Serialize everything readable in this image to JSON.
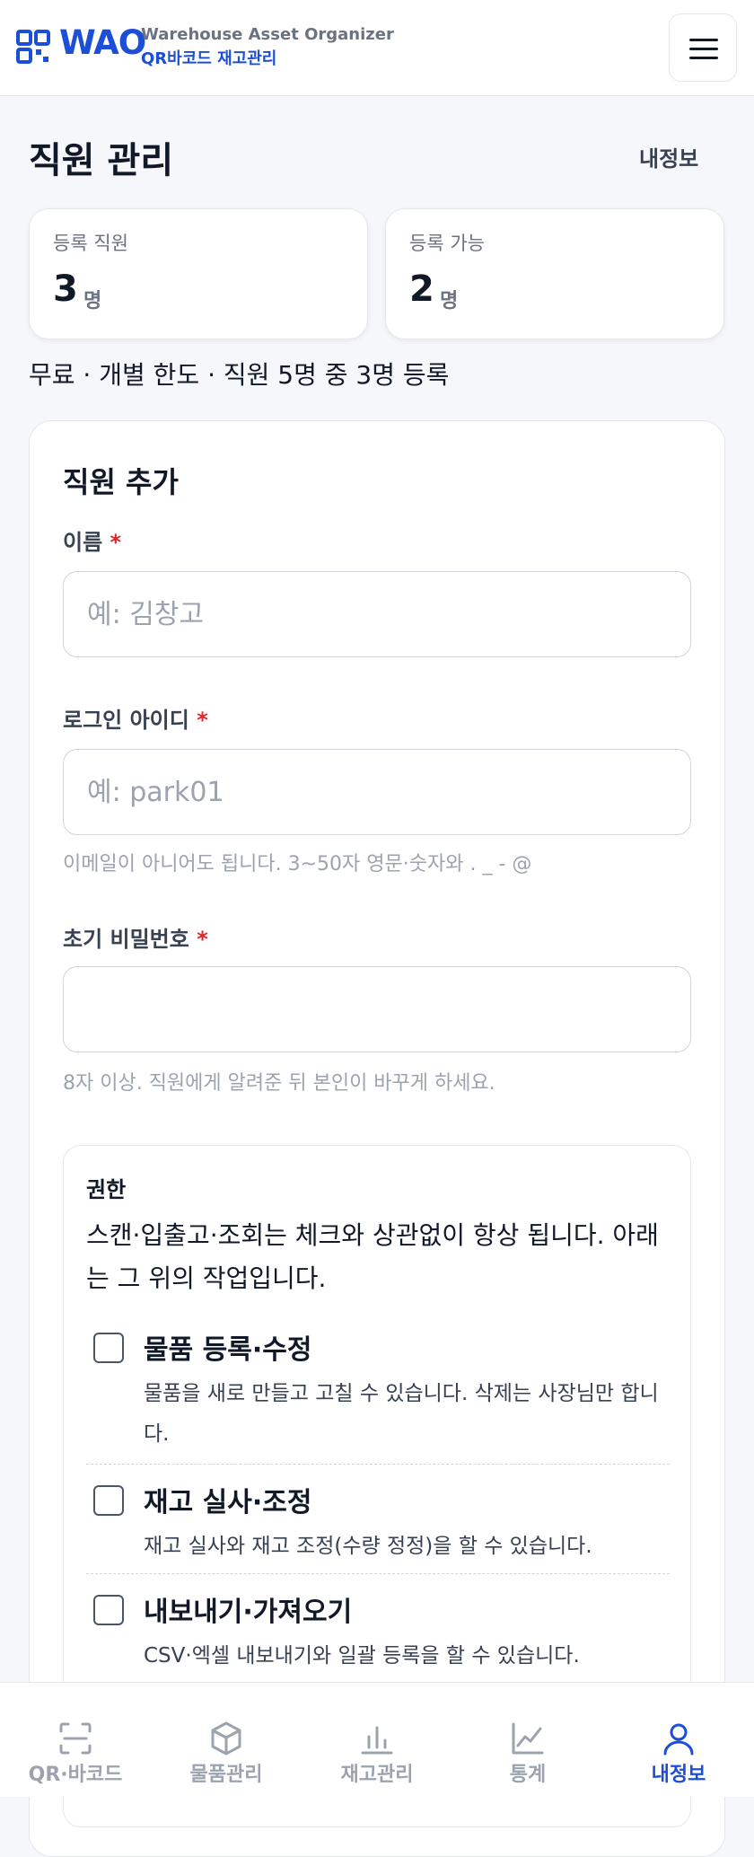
{
  "header": {
    "logo_text": "WAO",
    "subtitle_en": "Warehouse Asset Organizer",
    "subtitle_ko": "QR바코드 재고관리",
    "menu_icon": "hamburger-menu-icon"
  },
  "page": {
    "title": "직원 관리",
    "myinfo_link": "내정보"
  },
  "stats": [
    {
      "label": "등록 직원",
      "value": "3",
      "unit": "명"
    },
    {
      "label": "등록 가능",
      "value": "2",
      "unit": "명"
    }
  ],
  "plan_text": "무료 · 개별 한도 · 직원 5명 중 3명 등록",
  "form": {
    "title": "직원 추가",
    "required_mark": "*",
    "name_label": "이름",
    "name_placeholder": "예: 김창고",
    "login_label": "로그인 아이디",
    "login_placeholder": "예: park01",
    "login_helper": "이메일이 아니어도 됩니다. 3~50자 영문·숫자와 . _ - @",
    "password_label": "초기 비밀번호",
    "password_placeholder": "",
    "password_helper": "8자 이상. 직원에게 알려준 뒤 본인이 바꾸게 하세요."
  },
  "permissions": {
    "title": "권한",
    "description": "스캔·입출고·조회는 체크와 상관없이 항상 됩니다. 아래는 그 위의 작업입니다.",
    "items": [
      {
        "name": "물품 등록·수정",
        "note": "물품을 새로 만들고 고칠 수 있습니다. 삭제는 사장님만 합니다.",
        "checked": false
      },
      {
        "name": "재고 실사·조정",
        "note": "재고 실사와 재고 조정(수량 정정)을 할 수 있습니다.",
        "checked": false
      },
      {
        "name": "내보내기·가져오기",
        "note": "CSV·엑셀 내보내기와 일괄 등록을 할 수 있습니다.",
        "checked": false
      }
    ]
  },
  "bottom_nav": [
    {
      "label": "QR·바코드",
      "icon": "qr-scan-icon",
      "active": false
    },
    {
      "label": "물품관리",
      "icon": "box-icon",
      "active": false
    },
    {
      "label": "재고관리",
      "icon": "bar-chart-icon",
      "active": false
    },
    {
      "label": "통계",
      "icon": "line-chart-icon",
      "active": false
    },
    {
      "label": "내정보",
      "icon": "user-icon",
      "active": true
    }
  ],
  "colors": {
    "brand": "#1d4ed8",
    "required": "#dc2626",
    "muted": "#9ca3af"
  }
}
